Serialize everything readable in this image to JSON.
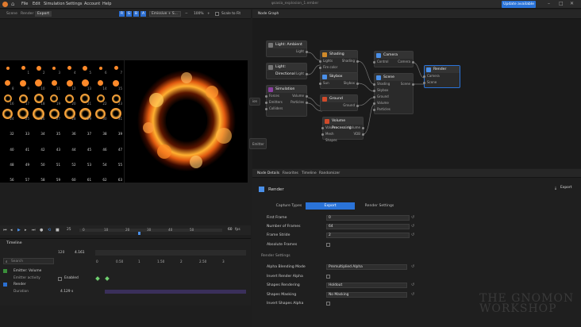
{
  "app": {
    "title": "ψsasia_explosion_1.ember",
    "menu": [
      "File",
      "Edit",
      "Simulation",
      "Settings",
      "Account",
      "Help"
    ],
    "update_button": "Update available",
    "window_controls": [
      "minimize-icon",
      "maximize-icon",
      "close-icon"
    ]
  },
  "viewport": {
    "tabs": [
      "Scene",
      "Render",
      "Export"
    ],
    "active_tab": "Export",
    "channels": [
      "R",
      "G",
      "B",
      "A"
    ],
    "layer_dropdown": "Emissive + S...",
    "zoom": "100%",
    "scale_to_fit_label": "Scale to Fit",
    "sprite_labels": [
      "1",
      "2",
      "3",
      "4",
      "5",
      "6",
      "7",
      "8",
      "9",
      "10",
      "11",
      "12",
      "13",
      "14",
      "15",
      "16",
      "17",
      "18",
      "19",
      "20",
      "21",
      "22",
      "23",
      "24",
      "25",
      "26",
      "27",
      "28",
      "29",
      "30",
      "31",
      "32",
      "33",
      "34",
      "35",
      "36",
      "37",
      "38",
      "39",
      "40",
      "41",
      "42",
      "43",
      "44",
      "45",
      "46",
      "47",
      "48",
      "49",
      "50",
      "51",
      "52",
      "53",
      "54",
      "55",
      "56",
      "57",
      "58",
      "59",
      "60",
      "61",
      "62",
      "63"
    ]
  },
  "playback": {
    "current_frame": "25",
    "end_frame": "60",
    "fps": "fps",
    "ruler": [
      "0",
      "10",
      "20",
      "30",
      "40",
      "50"
    ]
  },
  "timeline": {
    "title": "Timeline",
    "search_placeholder": "Search",
    "time_a": "120",
    "time_b": "4.161",
    "ruler": [
      "0",
      "0.50",
      "1",
      "1.50",
      "2",
      "2.50",
      "3"
    ],
    "rows": [
      {
        "label": "Emitter: Volume",
        "value": ""
      },
      {
        "label": "Emitter activity",
        "value": "Enabled"
      },
      {
        "label": "Render",
        "value": ""
      },
      {
        "label": "Duration",
        "value": "4.129 s"
      }
    ]
  },
  "node_graph": {
    "title": "Node Graph",
    "nodes": [
      {
        "id": "ambient",
        "title": "Light: Ambient",
        "ports_out": [
          "Light"
        ]
      },
      {
        "id": "directional",
        "title": "Light: Directional",
        "ports_out": [
          "Light"
        ]
      },
      {
        "id": "simulation",
        "title": "Simulation",
        "ports_in": [
          "Forces",
          "Emitters",
          "Colliders"
        ],
        "ports_out": [
          "Volume",
          "Particles"
        ]
      },
      {
        "id": "shading",
        "title": "Shading",
        "ports_in": [
          "Lights",
          "Fire color"
        ],
        "ports_out": [
          "Shading"
        ]
      },
      {
        "id": "skybox",
        "title": "Skybox",
        "ports_in": [
          "Sun"
        ],
        "ports_out": [
          "Skybox"
        ]
      },
      {
        "id": "ground",
        "title": "Ground",
        "ports_out": [
          "Ground"
        ]
      },
      {
        "id": "volume",
        "title": "Volume Processing",
        "ports_in": [
          "Volume",
          "Mesh Shapes"
        ],
        "ports_out": [
          "Volume",
          "VDB"
        ]
      },
      {
        "id": "camera",
        "title": "Camera",
        "ports_in": [
          "Control"
        ],
        "ports_out": [
          "Camera"
        ]
      },
      {
        "id": "scene",
        "title": "Scene",
        "ports_in": [
          "Shading",
          "Skybox",
          "Ground",
          "Volume",
          "Particles"
        ],
        "ports_out": [
          "Scene"
        ]
      },
      {
        "id": "render",
        "title": "Render",
        "ports_in": [
          "Camera",
          "Scene"
        ]
      }
    ],
    "stub_labels": [
      "ion",
      "Emitter"
    ]
  },
  "details": {
    "tabs": [
      "Node Details",
      "Favorites",
      "Timeline",
      "Randomizer"
    ],
    "active_tab": "Node Details",
    "node_title": "Render",
    "export_button": "Export",
    "subtabs": [
      "Capture Types",
      "Export",
      "Render Settings"
    ],
    "active_subtab": "Export",
    "properties": [
      {
        "label": "First Frame",
        "value": "0",
        "type": "field"
      },
      {
        "label": "Number of Frames",
        "value": "64",
        "type": "field"
      },
      {
        "label": "Frame Stride",
        "value": "2",
        "type": "field"
      },
      {
        "label": "Absolute Frames",
        "value": "",
        "type": "checkbox"
      }
    ],
    "section_title": "Render Settings",
    "render_settings": [
      {
        "label": "Alpha Blending Mode",
        "value": "Premultiplied Alpha",
        "type": "dropdown"
      },
      {
        "label": "Invert Render Alpha",
        "value": "",
        "type": "checkbox"
      },
      {
        "label": "Shapes Rendering",
        "value": "Holdout",
        "type": "dropdown"
      },
      {
        "label": "Shapes Masking",
        "value": "No Masking",
        "type": "dropdown"
      },
      {
        "label": "Invert Shapes Alpha",
        "value": "",
        "type": "checkbox"
      }
    ]
  },
  "watermark": {
    "line1": "THE GNOMON",
    "line2": "WORKSHOP"
  }
}
